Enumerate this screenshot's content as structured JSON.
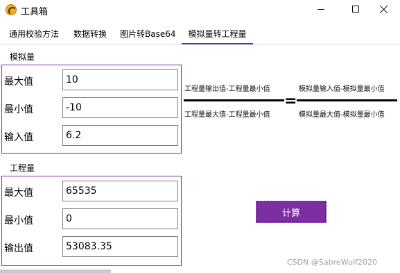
{
  "window": {
    "title": "工具箱",
    "icon": "app-logo-icon"
  },
  "tabs": [
    {
      "label": "通用校验方法",
      "active": false
    },
    {
      "label": "数据转换",
      "active": false
    },
    {
      "label": "图片转Base64",
      "active": false
    },
    {
      "label": "模拟量转工程量",
      "active": true
    }
  ],
  "analog": {
    "group_label": "模拟量",
    "max_label": "最大值",
    "max_value": "10",
    "min_label": "最小值",
    "min_value": "-10",
    "input_label": "输入值",
    "input_value": "6.2"
  },
  "engineering": {
    "group_label": "工程量",
    "max_label": "最大值",
    "max_value": "65535",
    "min_label": "最小值",
    "min_value": "0",
    "output_label": "输出值",
    "output_value": "53083.35"
  },
  "formula": {
    "left_numerator": "工程量输出值-工程量最小值",
    "left_denominator": "工程量最大值-工程量最小值",
    "equals": "=",
    "right_numerator": "模拟量输入值-模拟量最小值",
    "right_denominator": "模拟量最大值-模拟量最小值"
  },
  "calculate_button": "计算",
  "watermark": "CSDN @SabreWulf2020",
  "colors": {
    "accent": "#7d2ea3",
    "group_border": "#7b2fa3"
  }
}
